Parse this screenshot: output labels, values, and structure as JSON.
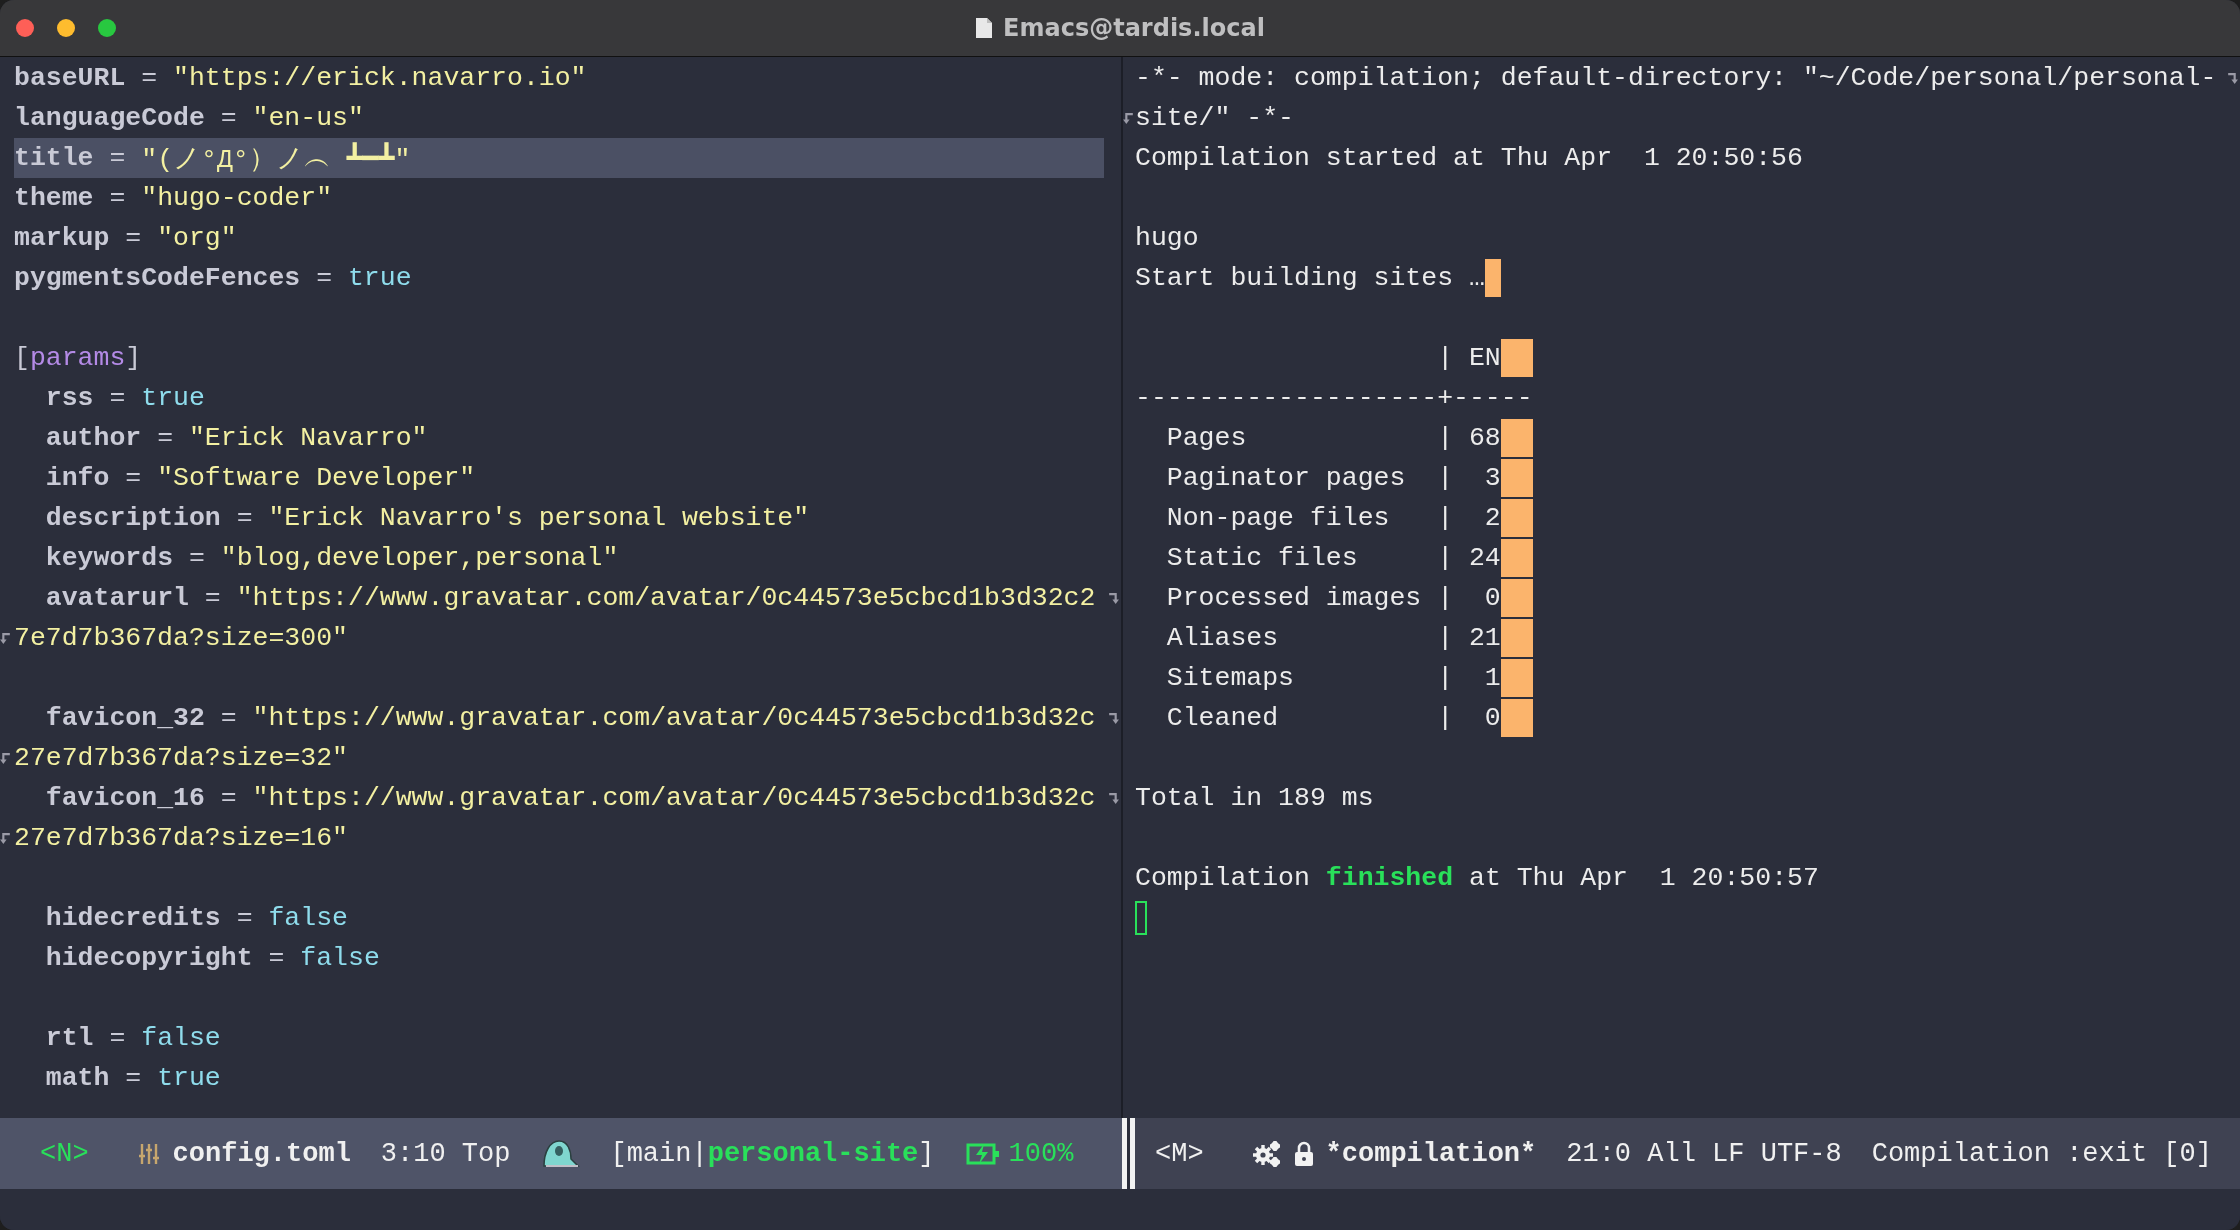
{
  "window": {
    "title": "Emacs@tardis.local"
  },
  "editor": {
    "lines": [
      {
        "kind": "code",
        "highlighted": false,
        "segments": [
          {
            "kind": "key",
            "text": "baseURL"
          },
          {
            "kind": "op",
            "text": " = "
          },
          {
            "kind": "string",
            "text": "\"https://erick.navarro.io\""
          }
        ]
      },
      {
        "kind": "code",
        "highlighted": false,
        "segments": [
          {
            "kind": "key",
            "text": "languageCode"
          },
          {
            "kind": "op",
            "text": " = "
          },
          {
            "kind": "string",
            "text": "\"en-us\""
          }
        ]
      },
      {
        "kind": "code",
        "highlighted": true,
        "segments": [
          {
            "kind": "key",
            "text": "title"
          },
          {
            "kind": "op",
            "text": " = "
          },
          {
            "kind": "string",
            "text": "\"(ノ°Д°）ノ︵ ┻━┻\""
          }
        ]
      },
      {
        "kind": "code",
        "highlighted": false,
        "segments": [
          {
            "kind": "key",
            "text": "theme"
          },
          {
            "kind": "op",
            "text": " = "
          },
          {
            "kind": "string",
            "text": "\"hugo-coder\""
          }
        ]
      },
      {
        "kind": "code",
        "highlighted": false,
        "segments": [
          {
            "kind": "key",
            "text": "markup"
          },
          {
            "kind": "op",
            "text": " = "
          },
          {
            "kind": "string",
            "text": "\"org\""
          }
        ]
      },
      {
        "kind": "code",
        "highlighted": false,
        "segments": [
          {
            "kind": "key",
            "text": "pygmentsCodeFences"
          },
          {
            "kind": "op",
            "text": " = "
          },
          {
            "kind": "bool",
            "text": "true"
          }
        ]
      },
      {
        "kind": "blank"
      },
      {
        "kind": "code",
        "highlighted": false,
        "segments": [
          {
            "kind": "op",
            "text": "["
          },
          {
            "kind": "section",
            "text": "params"
          },
          {
            "kind": "op",
            "text": "]"
          }
        ],
        "children": [
          {
            "kind": "code",
            "highlighted": false,
            "segments": [
              {
                "kind": "key",
                "text": "rss"
              },
              {
                "kind": "op",
                "text": " = "
              },
              {
                "kind": "bool",
                "text": "true"
              }
            ]
          },
          {
            "kind": "code",
            "highlighted": false,
            "segments": [
              {
                "kind": "key",
                "text": "author"
              },
              {
                "kind": "op",
                "text": " = "
              },
              {
                "kind": "string",
                "text": "\"Erick Navarro\""
              }
            ]
          },
          {
            "kind": "code",
            "highlighted": false,
            "segments": [
              {
                "kind": "key",
                "text": "info"
              },
              {
                "kind": "op",
                "text": " = "
              },
              {
                "kind": "string",
                "text": "\"Software Developer\""
              }
            ]
          },
          {
            "kind": "code",
            "highlighted": false,
            "segments": [
              {
                "kind": "key",
                "text": "description"
              },
              {
                "kind": "op",
                "text": " = "
              },
              {
                "kind": "string",
                "text": "\"Erick Navarro's personal website\""
              }
            ]
          },
          {
            "kind": "code",
            "highlighted": false,
            "segments": [
              {
                "kind": "key",
                "text": "keywords"
              },
              {
                "kind": "op",
                "text": " = "
              },
              {
                "kind": "string",
                "text": "\"blog,developer,personal\""
              }
            ]
          },
          {
            "kind": "code",
            "highlighted": false,
            "segments": [
              {
                "kind": "key",
                "text": "avatarurl"
              },
              {
                "kind": "op",
                "text": " = "
              },
              {
                "kind": "string",
                "text": "\"https://www.gravatar.com/avatar/0c44573e5cbcd1b3d32c2"
              }
            ],
            "continuation": {
              "kind": "string",
              "text": "7e7d7b367da?size=300\""
            }
          },
          {
            "kind": "blank"
          },
          {
            "kind": "code",
            "highlighted": false,
            "segments": [
              {
                "kind": "key",
                "text": "favicon_32"
              },
              {
                "kind": "op",
                "text": " = "
              },
              {
                "kind": "string",
                "text": "\"https://www.gravatar.com/avatar/0c44573e5cbcd1b3d32c"
              }
            ],
            "continuation": {
              "kind": "string",
              "text": "27e7d7b367da?size=32\""
            }
          },
          {
            "kind": "code",
            "highlighted": false,
            "segments": [
              {
                "kind": "key",
                "text": "favicon_16"
              },
              {
                "kind": "op",
                "text": " = "
              },
              {
                "kind": "string",
                "text": "\"https://www.gravatar.com/avatar/0c44573e5cbcd1b3d32c"
              }
            ],
            "continuation": {
              "kind": "string",
              "text": "27e7d7b367da?size=16\""
            }
          },
          {
            "kind": "blank"
          },
          {
            "kind": "code",
            "highlighted": false,
            "segments": [
              {
                "kind": "key",
                "text": "hidecredits"
              },
              {
                "kind": "op",
                "text": " = "
              },
              {
                "kind": "bool",
                "text": "false"
              }
            ]
          },
          {
            "kind": "code",
            "highlighted": false,
            "segments": [
              {
                "kind": "key",
                "text": "hidecopyright"
              },
              {
                "kind": "op",
                "text": " = "
              },
              {
                "kind": "bool",
                "text": "false"
              }
            ]
          },
          {
            "kind": "blank"
          },
          {
            "kind": "code",
            "highlighted": false,
            "segments": [
              {
                "kind": "key",
                "text": "rtl"
              },
              {
                "kind": "op",
                "text": " = "
              },
              {
                "kind": "bool",
                "text": "false"
              }
            ]
          },
          {
            "kind": "code",
            "highlighted": false,
            "segments": [
              {
                "kind": "key",
                "text": "math"
              },
              {
                "kind": "op",
                "text": " = "
              },
              {
                "kind": "bool",
                "text": "true"
              }
            ]
          }
        ]
      }
    ]
  },
  "compilation": {
    "lines": [
      {
        "kind": "code",
        "segments": [
          {
            "kind": "plain",
            "text": "-*- mode: compilation; default-directory: \"~/Code/personal/personal-"
          }
        ],
        "continuation": {
          "kind": "plain",
          "text": "site/\" -*-"
        }
      },
      {
        "kind": "code",
        "segments": [
          {
            "kind": "plain",
            "text": "Compilation started at Thu Apr  1 20:50:56"
          }
        ]
      },
      {
        "kind": "blank"
      },
      {
        "kind": "code",
        "segments": [
          {
            "kind": "plain",
            "text": "hugo"
          }
        ]
      },
      {
        "kind": "code",
        "trailing_whitespace": true,
        "segments": [
          {
            "kind": "plain",
            "text": "Start building sites …"
          }
        ]
      },
      {
        "kind": "blank"
      },
      {
        "kind": "table_row",
        "trailing_whitespace": true,
        "segments": [
          {
            "kind": "plain",
            "text": "                   | EN"
          }
        ]
      },
      {
        "kind": "table_row",
        "trailing_whitespace": false,
        "segments": [
          {
            "kind": "plain",
            "text": "-------------------+-----"
          }
        ]
      },
      {
        "kind": "table_row",
        "trailing_whitespace": true,
        "segments": [
          {
            "kind": "plain",
            "text": "  Pages            | 68"
          }
        ]
      },
      {
        "kind": "table_row",
        "trailing_whitespace": true,
        "segments": [
          {
            "kind": "plain",
            "text": "  Paginator pages  |  3"
          }
        ]
      },
      {
        "kind": "table_row",
        "trailing_whitespace": true,
        "segments": [
          {
            "kind": "plain",
            "text": "  Non-page files   |  2"
          }
        ]
      },
      {
        "kind": "table_row",
        "trailing_whitespace": true,
        "segments": [
          {
            "kind": "plain",
            "text": "  Static files     | 24"
          }
        ]
      },
      {
        "kind": "table_row",
        "trailing_whitespace": true,
        "segments": [
          {
            "kind": "plain",
            "text": "  Processed images |  0"
          }
        ]
      },
      {
        "kind": "table_row",
        "trailing_whitespace": true,
        "segments": [
          {
            "kind": "plain",
            "text": "  Aliases          | 21"
          }
        ]
      },
      {
        "kind": "table_row",
        "trailing_whitespace": true,
        "segments": [
          {
            "kind": "plain",
            "text": "  Sitemaps         |  1"
          }
        ]
      },
      {
        "kind": "table_row",
        "trailing_whitespace": true,
        "segments": [
          {
            "kind": "plain",
            "text": "  Cleaned          |  0"
          }
        ]
      },
      {
        "kind": "blank"
      },
      {
        "kind": "code",
        "segments": [
          {
            "kind": "plain",
            "text": "Total in 189 ms"
          }
        ]
      },
      {
        "kind": "blank"
      },
      {
        "kind": "code",
        "segments": [
          {
            "kind": "plain",
            "text": "Compilation "
          },
          {
            "kind": "success",
            "text": "finished"
          },
          {
            "kind": "plain",
            "text": " at Thu Apr  1 20:50:57"
          }
        ]
      },
      {
        "kind": "cursor"
      }
    ]
  },
  "mode_lines": [
    {
      "active": true,
      "kind": "file",
      "state": "<N>",
      "file": "config.toml",
      "position": "3:10 Top",
      "branch_open": "[main|",
      "project": "personal-site",
      "branch_close": "]",
      "battery": "100%"
    },
    {
      "active": false,
      "kind": "process",
      "state": "<M>",
      "buffer": "*compilation*",
      "position": "21:0 All LF UTF-8",
      "process": "Compilation :exit [0]"
    }
  ]
}
